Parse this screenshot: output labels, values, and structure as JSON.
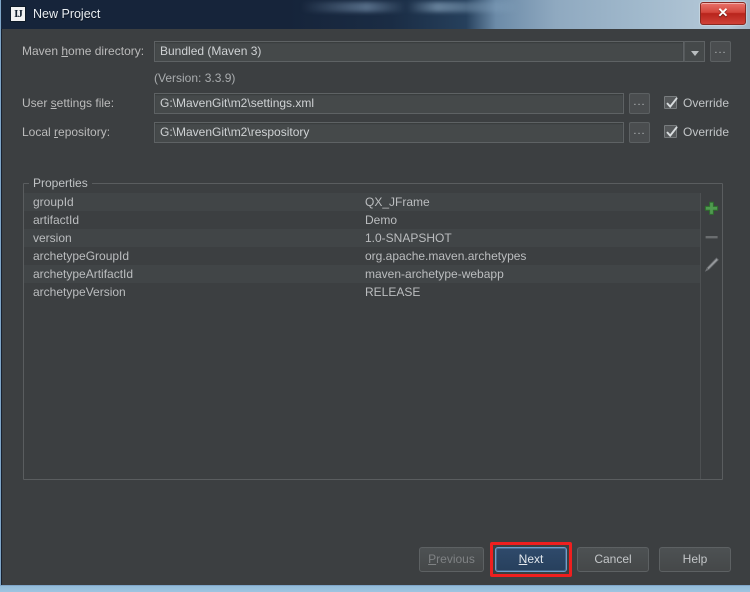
{
  "window": {
    "title": "New Project",
    "app_icon": "intellij-idea-icon",
    "close_label": "✕"
  },
  "form": {
    "maven_home": {
      "label_prefix": "Maven ",
      "label_mnemonic": "h",
      "label_suffix": "ome directory:",
      "value": "Bundled (Maven 3)",
      "browse_label": "...",
      "dropdown_icon": "chevron-down-icon"
    },
    "version_note": "(Version: 3.3.9)",
    "user_settings": {
      "label_prefix": "User ",
      "label_mnemonic": "s",
      "label_suffix": "ettings file:",
      "value": "G:\\MavenGit\\m2\\settings.xml",
      "browse_label": "...",
      "override_label": "Override",
      "override_checked": true
    },
    "local_repository": {
      "label_prefix": "Local ",
      "label_mnemonic": "r",
      "label_suffix": "epository:",
      "value": "G:\\MavenGit\\m2\\respository",
      "browse_label": "...",
      "override_label": "Override",
      "override_checked": true
    }
  },
  "properties": {
    "group_title": "Properties",
    "rows": [
      {
        "key": "groupId",
        "value": "QX_JFrame"
      },
      {
        "key": "artifactId",
        "value": "Demo"
      },
      {
        "key": "version",
        "value": "1.0-SNAPSHOT"
      },
      {
        "key": "archetypeGroupId",
        "value": "org.apache.maven.archetypes"
      },
      {
        "key": "archetypeArtifactId",
        "value": "maven-archetype-webapp"
      },
      {
        "key": "archetypeVersion",
        "value": "RELEASE"
      }
    ],
    "toolbar": [
      {
        "name": "add-property-button",
        "icon": "plus-icon",
        "enabled": true
      },
      {
        "name": "remove-property-button",
        "icon": "minus-icon",
        "enabled": false
      },
      {
        "name": "edit-property-button",
        "icon": "pencil-icon",
        "enabled": true
      }
    ]
  },
  "footer": {
    "previous": {
      "prefix": "",
      "mnemonic": "P",
      "suffix": "revious",
      "disabled": true
    },
    "next": {
      "prefix": "",
      "mnemonic": "N",
      "suffix": "ext",
      "focused": true
    },
    "cancel": {
      "label": "Cancel"
    },
    "help": {
      "label": "Help"
    }
  },
  "annotation": {
    "highlight_target": "next-button",
    "highlight_color": "#ef1f1f"
  }
}
